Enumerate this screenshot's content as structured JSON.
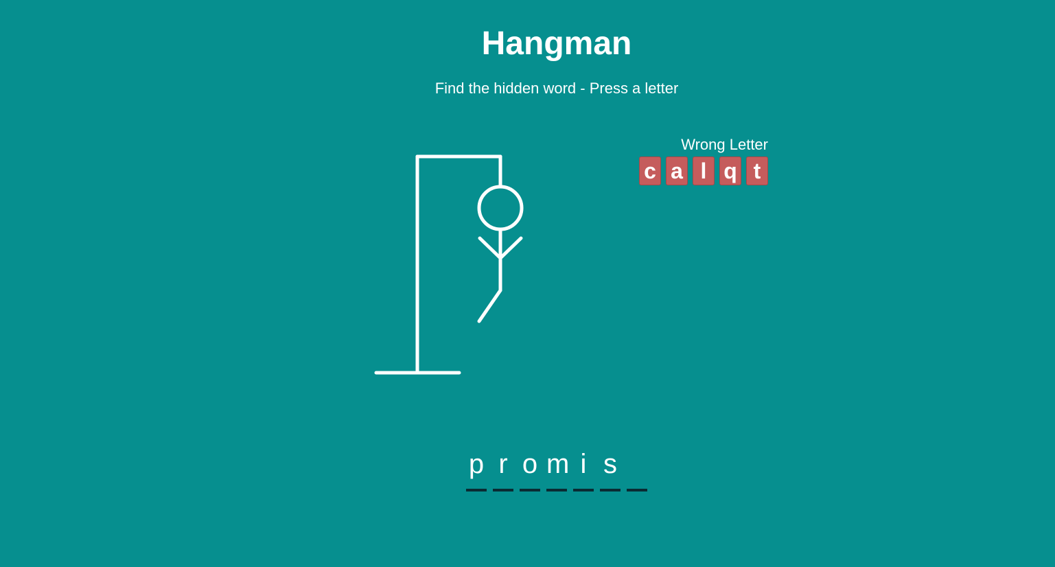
{
  "header": {
    "title": "Hangman",
    "subtitle": "Find the hidden word - Press a letter"
  },
  "wrong": {
    "label": "Wrong Letter",
    "letters": [
      "c",
      "a",
      "l",
      "q",
      "t"
    ]
  },
  "word": {
    "slots": [
      "p",
      "r",
      "o",
      "m",
      "i",
      "s",
      ""
    ]
  },
  "figure": {
    "parts_shown": [
      "head",
      "body",
      "left-arm",
      "right-arm",
      "left-leg"
    ]
  },
  "colors": {
    "background": "#068f8f",
    "wrong_letter_bg": "#c55c5c",
    "slot_underline": "#0b2b33",
    "text": "#ffffff"
  }
}
